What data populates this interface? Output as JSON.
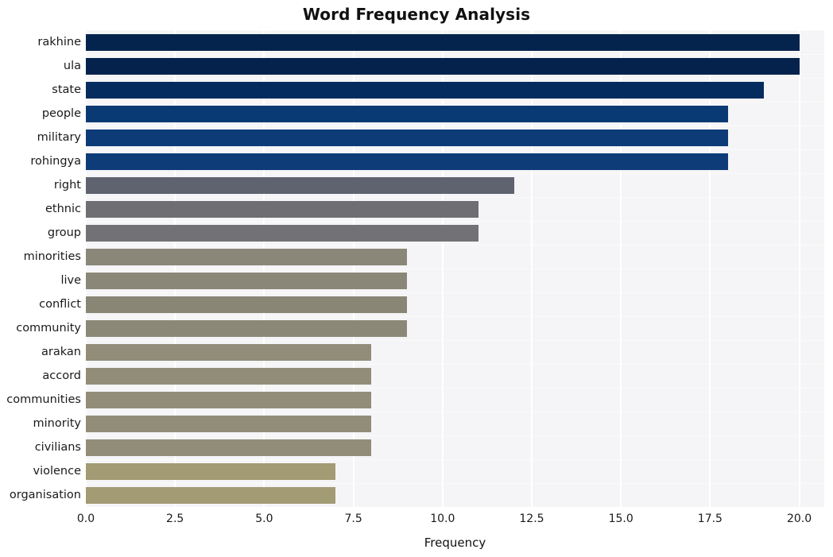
{
  "chart_data": {
    "type": "bar",
    "orientation": "horizontal",
    "title": "Word Frequency Analysis",
    "xlabel": "Frequency",
    "ylabel": "",
    "xlim": [
      0,
      20.7
    ],
    "ylim": null,
    "grid": true,
    "legend": null,
    "xticks": [
      "0.0",
      "2.5",
      "5.0",
      "7.5",
      "10.0",
      "12.5",
      "15.0",
      "17.5",
      "20.0"
    ],
    "xtick_values": [
      0,
      2.5,
      5.0,
      7.5,
      10.0,
      12.5,
      15.0,
      17.5,
      20.0
    ],
    "categories": [
      "rakhine",
      "ula",
      "state",
      "people",
      "military",
      "rohingya",
      "right",
      "ethnic",
      "group",
      "minorities",
      "live",
      "conflict",
      "community",
      "arakan",
      "accord",
      "communities",
      "minority",
      "civilians",
      "violence",
      "organisation"
    ],
    "values": [
      20,
      20,
      19,
      18,
      18,
      18,
      12,
      11,
      11,
      9,
      9,
      9,
      9,
      8,
      8,
      8,
      8,
      8,
      7,
      7
    ],
    "bar_colors": [
      "#04234d",
      "#04224c",
      "#042c5e",
      "#0a3a74",
      "#0c3b77",
      "#0d3c79",
      "#5f636f",
      "#6e6e73",
      "#717176",
      "#8b8778",
      "#8b8778",
      "#8a8676",
      "#8c8878",
      "#918d79",
      "#918d79",
      "#918d79",
      "#918d79",
      "#918d79",
      "#a39b74",
      "#a39b74"
    ],
    "plot_bg": "#f5f5f7",
    "grid_color": "#ffffff",
    "figure_bg": "#ffffff"
  }
}
